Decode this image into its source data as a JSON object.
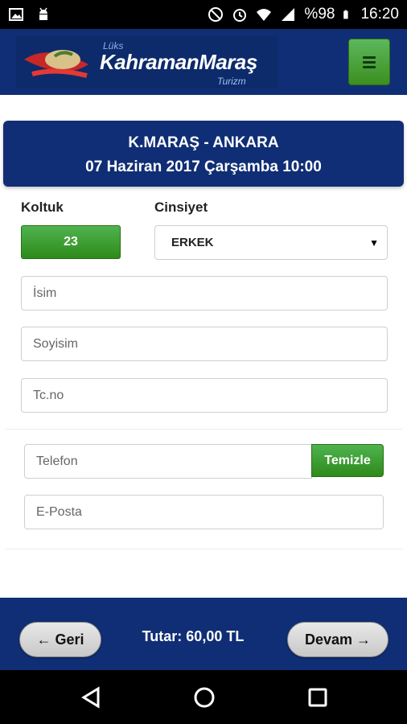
{
  "status_bar": {
    "battery": "%98",
    "time": "16:20",
    "icons": [
      "image-icon",
      "android-icon",
      "do-not-disturb-icon",
      "alarm-icon",
      "wifi-icon",
      "signal-icon",
      "battery-icon"
    ]
  },
  "header": {
    "logo_small": "Lüks",
    "logo_main": "KahramanMaraş",
    "logo_sub": "Turizm",
    "menu_icon": "hamburger-menu-icon"
  },
  "route": {
    "title": "K.MARAŞ - ANKARA",
    "datetime": "07 Haziran 2017 Çarşamba 10:00"
  },
  "form": {
    "seat_label": "Koltuk",
    "seat_value": "23",
    "gender_label": "Cinsiyet",
    "gender_value": "ERKEK",
    "first_name_placeholder": "İsim",
    "last_name_placeholder": "Soyisim",
    "tc_placeholder": "Tc.no",
    "phone_placeholder": "Telefon",
    "clear_label": "Temizle",
    "email_placeholder": "E-Posta"
  },
  "footer": {
    "back_label": "← Geri",
    "total_label": "Tutar: 60,00 TL",
    "next_label": "Devam →"
  },
  "colors": {
    "brand_blue": "#102e75",
    "accent_green": "#3c8f1f"
  }
}
